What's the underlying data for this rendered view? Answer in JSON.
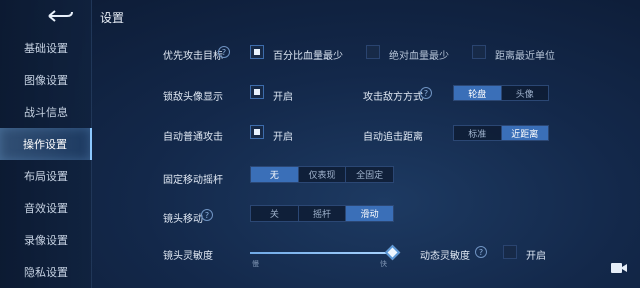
{
  "page_title": "设置",
  "sidebar": {
    "items": [
      {
        "label": "基础设置"
      },
      {
        "label": "图像设置"
      },
      {
        "label": "战斗信息"
      },
      {
        "label": "操作设置"
      },
      {
        "label": "布局设置"
      },
      {
        "label": "音效设置"
      },
      {
        "label": "录像设置"
      },
      {
        "label": "隐私设置"
      }
    ],
    "active": "操作设置"
  },
  "settings": {
    "priority_target": {
      "label": "优先攻击目标",
      "options": [
        {
          "label": "百分比血量最少",
          "checked": true
        },
        {
          "label": "绝对血量最少",
          "checked": false
        },
        {
          "label": "距离最近单位",
          "checked": false
        }
      ]
    },
    "lock_avatar": {
      "label": "锁敌头像显示",
      "option": "开启",
      "checked": true
    },
    "attack_enemy_mode": {
      "label": "攻击敌方方式",
      "options": [
        "轮盘",
        "头像"
      ],
      "selected": "轮盘"
    },
    "auto_attack": {
      "label": "自动普通攻击",
      "option": "开启",
      "checked": true
    },
    "auto_chase": {
      "label": "自动追击距离",
      "options": [
        "标准",
        "近距离"
      ],
      "selected": "近距离"
    },
    "fixed_joystick": {
      "label": "固定移动摇杆",
      "options": [
        "无",
        "仅表现",
        "全固定"
      ],
      "selected": "无"
    },
    "camera_move": {
      "label": "镜头移动",
      "options": [
        "关",
        "摇杆",
        "滑动"
      ],
      "selected": "滑动"
    },
    "camera_sensitivity": {
      "label": "镜头灵敏度",
      "min_label": "慢",
      "max_label": "快",
      "value": 1.0
    },
    "dynamic_sensitivity": {
      "label": "动态灵敏度",
      "option": "开启",
      "checked": false
    }
  },
  "icons": {
    "back": "back-arrow-icon",
    "help": "question-icon",
    "camera": "video-camera-icon"
  },
  "colors": {
    "accent": "#3a6fb8",
    "background": "#13284a"
  }
}
